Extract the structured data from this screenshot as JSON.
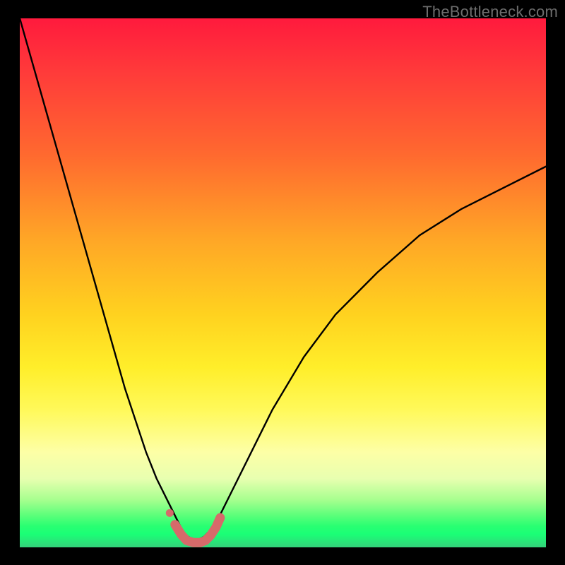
{
  "watermark": {
    "text": "TheBottleneck.com"
  },
  "colors": {
    "frame": "#000000",
    "curve": "#000000",
    "marker": "#d66a6a",
    "gradient_top": "#ff1a3d",
    "gradient_bottom": "#34d17a"
  },
  "chart_data": {
    "type": "line",
    "title": "",
    "xlabel": "",
    "ylabel": "",
    "xlim": [
      0,
      100
    ],
    "ylim": [
      0,
      100
    ],
    "series": [
      {
        "name": "bottleneck-curve",
        "x": [
          0,
          2,
          4,
          6,
          8,
          10,
          12,
          14,
          16,
          18,
          20,
          22,
          24,
          26,
          28,
          30,
          31,
          32,
          33,
          34,
          35,
          36,
          38,
          40,
          44,
          48,
          54,
          60,
          68,
          76,
          84,
          92,
          100
        ],
        "y": [
          100,
          93,
          86,
          79,
          72,
          65,
          58,
          51,
          44,
          37,
          30,
          24,
          18,
          13,
          9,
          5,
          3,
          2,
          1.5,
          1.5,
          2,
          3,
          6,
          10,
          18,
          26,
          36,
          44,
          52,
          59,
          64,
          68,
          72
        ]
      }
    ],
    "markers": {
      "name": "highlight-band",
      "points": [
        {
          "x": 29.5,
          "y": 4.3
        },
        {
          "x": 30.7,
          "y": 2.4
        },
        {
          "x": 31.7,
          "y": 1.3
        },
        {
          "x": 33.0,
          "y": 0.9
        },
        {
          "x": 34.3,
          "y": 0.9
        },
        {
          "x": 35.3,
          "y": 1.3
        },
        {
          "x": 36.3,
          "y": 2.3
        },
        {
          "x": 37.3,
          "y": 3.8
        },
        {
          "x": 38.1,
          "y": 5.6
        }
      ]
    }
  }
}
